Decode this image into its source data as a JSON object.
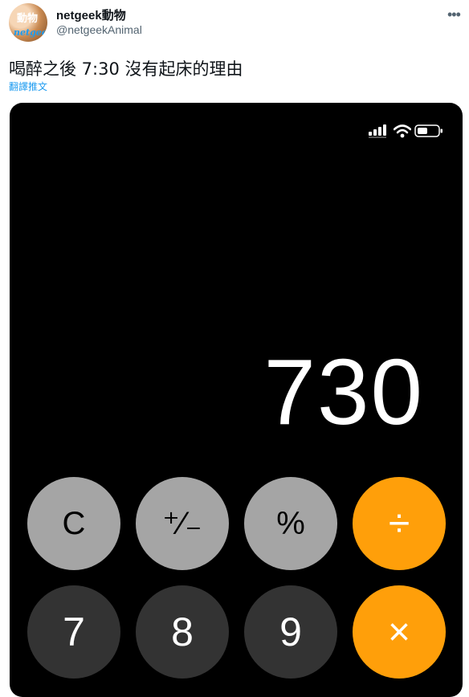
{
  "tweet": {
    "avatar_text": "動物",
    "avatar_brand": "netgeek",
    "display_name": "netgeek動物",
    "handle": "@netgeekAnimal",
    "more_label": "•••",
    "text": "喝醉之後 7:30 沒有起床的理由",
    "translate_label": "翻譯推文"
  },
  "calculator": {
    "display_value": "730",
    "keys_row1": [
      "C",
      "⁺∕₋",
      "%",
      "÷"
    ],
    "keys_row2": [
      "7",
      "8",
      "9",
      "×"
    ],
    "colors": {
      "function_key": "#a5a5a5",
      "operator_key": "#ff9f0a",
      "number_key": "#333333",
      "background": "#000000"
    }
  },
  "status_bar": {
    "icons": [
      "signal-icon",
      "wifi-icon",
      "battery-icon"
    ]
  }
}
